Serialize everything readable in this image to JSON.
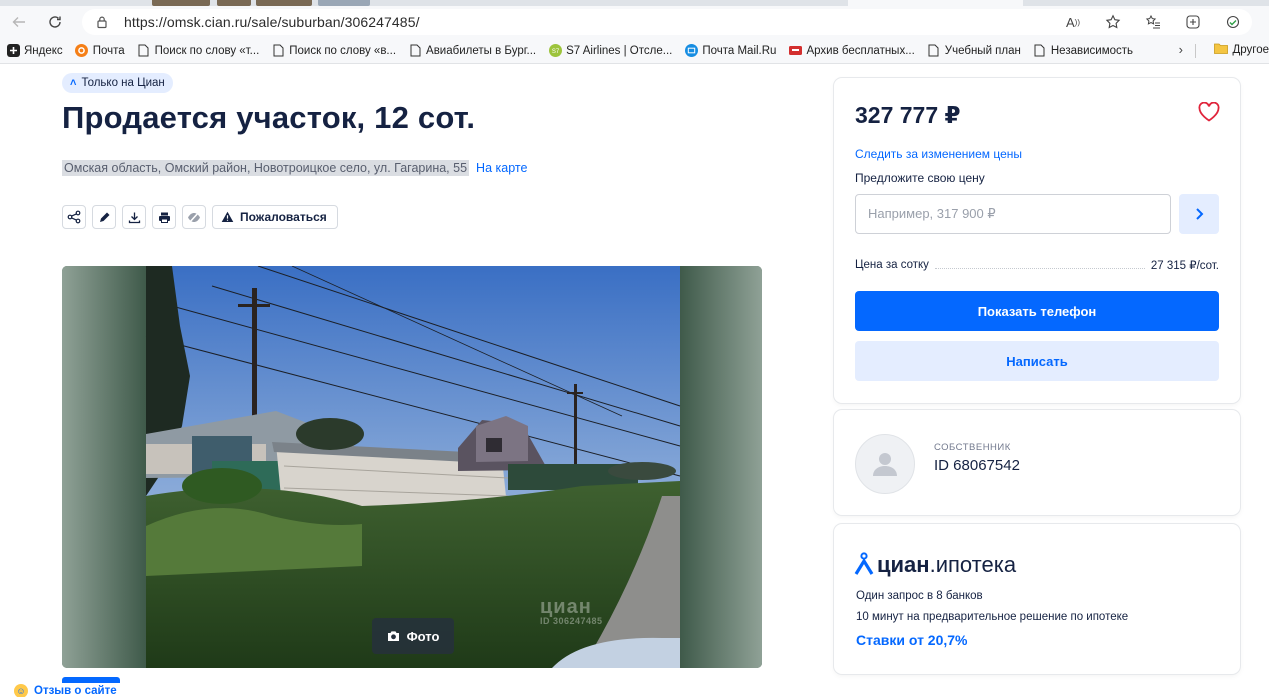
{
  "browser": {
    "url": "https://omsk.cian.ru/sale/suburban/306247485/",
    "bookmarks": [
      {
        "label": "Яндекс",
        "icon": "plus-square-icon"
      },
      {
        "label": "Почта",
        "icon": "mail-icon"
      },
      {
        "label": "Поиск по слову «т...",
        "icon": "page-icon"
      },
      {
        "label": "Поиск по слову «в...",
        "icon": "page-icon"
      },
      {
        "label": "Авиабилеты в Бург...",
        "icon": "page-icon"
      },
      {
        "label": "S7 Airlines | Отсле...",
        "icon": "s7-icon"
      },
      {
        "label": "Почта Mail.Ru",
        "icon": "mailru-icon"
      },
      {
        "label": "Архив бесплатных...",
        "icon": "archive-icon"
      },
      {
        "label": "Учебный план",
        "icon": "page-icon"
      },
      {
        "label": "Независимость",
        "icon": "page-icon"
      }
    ],
    "other_bookmarks": "Другое"
  },
  "listing": {
    "badge": "Только на Циан",
    "title": "Продается участок, 12 сот.",
    "address": "Омская область, Омский район, Новотроицкое село, ул. Гагарина, 55",
    "map_link": "На карте",
    "complain": "Пожаловаться",
    "photo_button": "Фото",
    "watermark": "циан",
    "watermark_id": "ID 306247485"
  },
  "price_card": {
    "price": "327 777 ₽",
    "track_price": "Следить за изменением цены",
    "offer_label": "Предложите свою цену",
    "offer_placeholder": "Например, 317 900 ₽",
    "per_unit_label": "Цена за сотку",
    "per_unit_value": "27 315 ₽/сот.",
    "show_phone": "Показать телефон",
    "write": "Написать"
  },
  "owner": {
    "role": "СОБСТВЕННИК",
    "id": "ID 68067542"
  },
  "mortgage": {
    "brand": "циан",
    "product": ".ипотека",
    "line1": "Один запрос в 8 банков",
    "line2": "10 минут на предварительное решение по ипотеке",
    "rates": "Ставки от 20,7%"
  },
  "feedback": "Отзыв о сайте",
  "colors": {
    "accent": "#0468ff",
    "accent_light": "#e4edff",
    "text": "#152242",
    "favorite": "#e0243b"
  }
}
